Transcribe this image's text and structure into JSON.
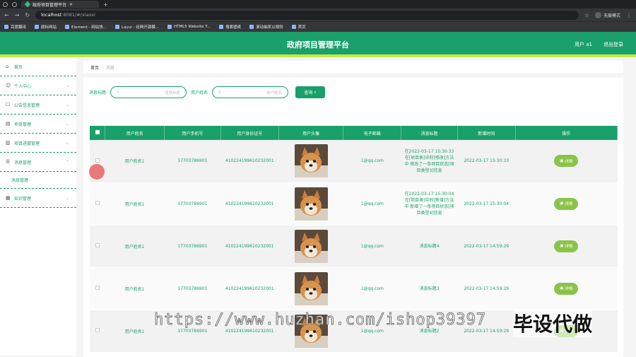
{
  "browser": {
    "tab_title": "政府项目管理平台",
    "url_host": "localhost",
    "url_path": ":8081/#/xiaoxi",
    "guest": "无痕模式",
    "bookmarks": [
      "百度翻译",
      "颜标网站",
      "Element - 网站快...",
      "Layui - 经典开源模...",
      "HTML5 Website T...",
      "搜索壁纸",
      "滚动抽奖以规则",
      "首页"
    ]
  },
  "header": {
    "title": "政府项目管理平台",
    "user": "用户 a1",
    "logout": "退出登录"
  },
  "sidebar": {
    "items": [
      {
        "label": "首页",
        "icon": "home-icon"
      },
      {
        "label": "个人中心",
        "icon": "user-icon"
      },
      {
        "label": "公告信息管理",
        "icon": "notice-icon"
      },
      {
        "label": "项目管理",
        "icon": "folder-icon"
      },
      {
        "label": "项目进度管理",
        "icon": "progress-icon"
      },
      {
        "label": "消息管理",
        "icon": "message-icon"
      },
      {
        "label": "知识管理",
        "icon": "book-icon"
      }
    ],
    "sub_item": "消息管理"
  },
  "breadcrumb": {
    "home": "首页",
    "sep": "/",
    "current": "消息"
  },
  "search": {
    "label1": "消息标题",
    "placeholder1": "消息标题",
    "label2": "用户姓名",
    "placeholder2": "用户姓名",
    "button": "查询"
  },
  "table": {
    "headers": [
      "用户姓名",
      "用户手机号",
      "用户身份证号",
      "用户头像",
      "电子邮箱",
      "消息标题",
      "新增时间",
      "操作"
    ],
    "rows": [
      {
        "name": "用户姓名1",
        "phone": "17703786901",
        "id": "410224199610232001",
        "email": "1@qq.com",
        "title": "在2022-03-17 15:30:33在[项目表]中的[修改]方法中 修改了一条项目状态[项目类型3]信息",
        "time": "2022-03-17 15:30:33",
        "action": "详情"
      },
      {
        "name": "用户姓名1",
        "phone": "17703786901",
        "id": "410224199610232001",
        "email": "1@qq.com",
        "title": "在2022-03-17 15:30:04在[项目表]中的[新增]方法中 新增了一条项目状态[项目类型4]信息",
        "time": "2022-03-17 15:30:04",
        "action": "详情"
      },
      {
        "name": "用户姓名1",
        "phone": "17703786901",
        "id": "410224199610232001",
        "email": "1@qq.com",
        "title": "消息标题4",
        "time": "2022-03-17 14:59:29",
        "action": "详情"
      },
      {
        "name": "用户姓名1",
        "phone": "17703786901",
        "id": "410224199610232001",
        "email": "1@qq.com",
        "title": "消息标题3",
        "time": "2022-03-17 14:59:29",
        "action": "详情"
      },
      {
        "name": "用户姓名1",
        "phone": "17703786901",
        "id": "410224199610232001",
        "email": "1@qq.com",
        "title": "消息标题2",
        "time": "2022-03-17 14:59:29",
        "action": "详情"
      }
    ]
  },
  "watermark": {
    "url": "https://www.huzhan.com/ishop39397",
    "tag": "毕设代做"
  },
  "colors": {
    "primary": "#1aa06a",
    "accent": "#c6e84a",
    "button": "#8bc34a"
  }
}
